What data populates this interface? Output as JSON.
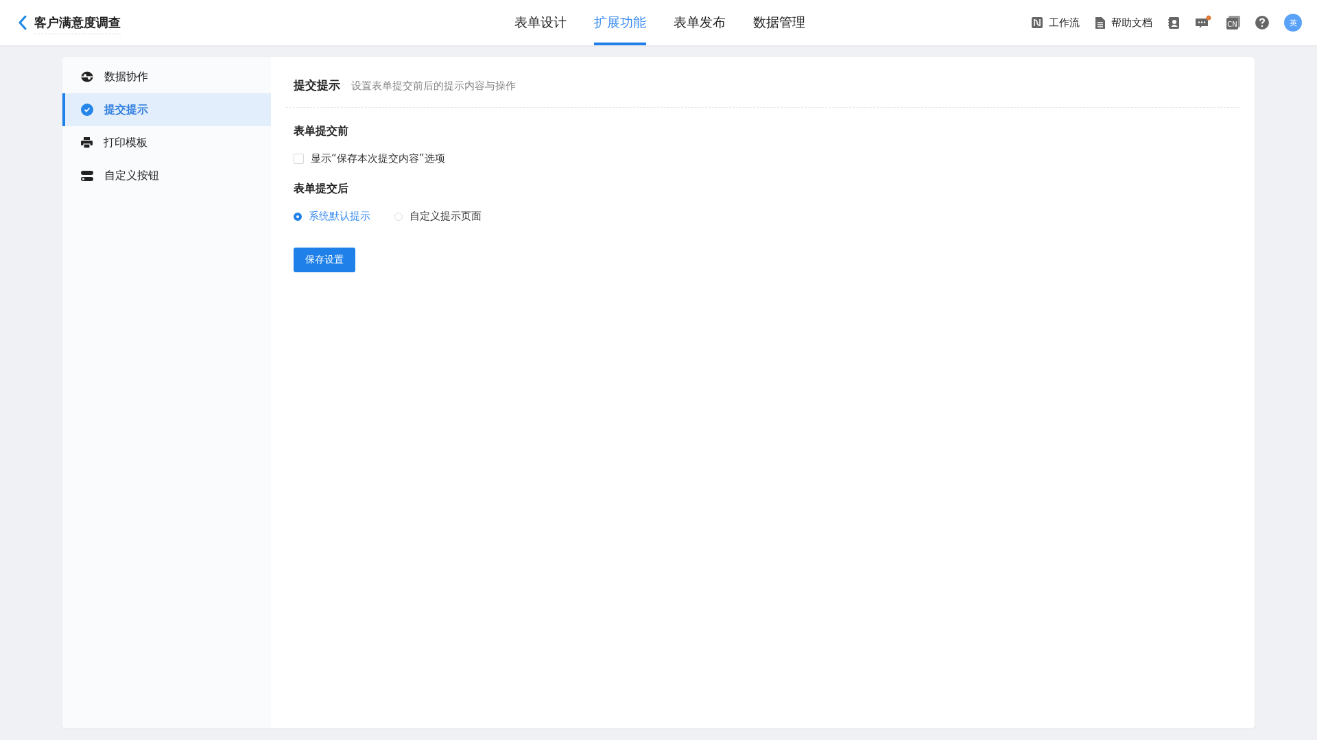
{
  "header": {
    "title": "客户满意度调查",
    "tabs": [
      {
        "label": "表单设计",
        "selected": false
      },
      {
        "label": "扩展功能",
        "selected": true
      },
      {
        "label": "表单发布",
        "selected": false
      },
      {
        "label": "数据管理",
        "selected": false
      }
    ],
    "tools": [
      {
        "kind": "workflow",
        "label": "工作流"
      },
      {
        "kind": "doc",
        "label": "帮助文档"
      }
    ],
    "icons": [
      {
        "kind": "contacts"
      },
      {
        "kind": "chat",
        "badge": true
      },
      {
        "kind": "lang",
        "text": "CN"
      },
      {
        "kind": "help"
      }
    ],
    "avatar": "英"
  },
  "sidebar": {
    "items": [
      {
        "kind": "share",
        "label": "数据协作",
        "selected": false
      },
      {
        "kind": "check",
        "label": "提交提示",
        "selected": true
      },
      {
        "kind": "print",
        "label": "打印模板",
        "selected": false
      },
      {
        "kind": "toggle",
        "label": "自定义按钮",
        "selected": false
      }
    ]
  },
  "content": {
    "title": "提交提示",
    "subtitle": "设置表单提交前后的提示内容与操作",
    "before": {
      "heading": "表单提交前",
      "checkbox": {
        "label": "显示“保存本次提交内容”选项",
        "checked": false
      }
    },
    "after": {
      "heading": "表单提交后",
      "options": [
        {
          "label": "系统默认提示",
          "selected": true
        },
        {
          "label": "自定义提示页面",
          "selected": false
        }
      ]
    },
    "save": "保存设置"
  }
}
